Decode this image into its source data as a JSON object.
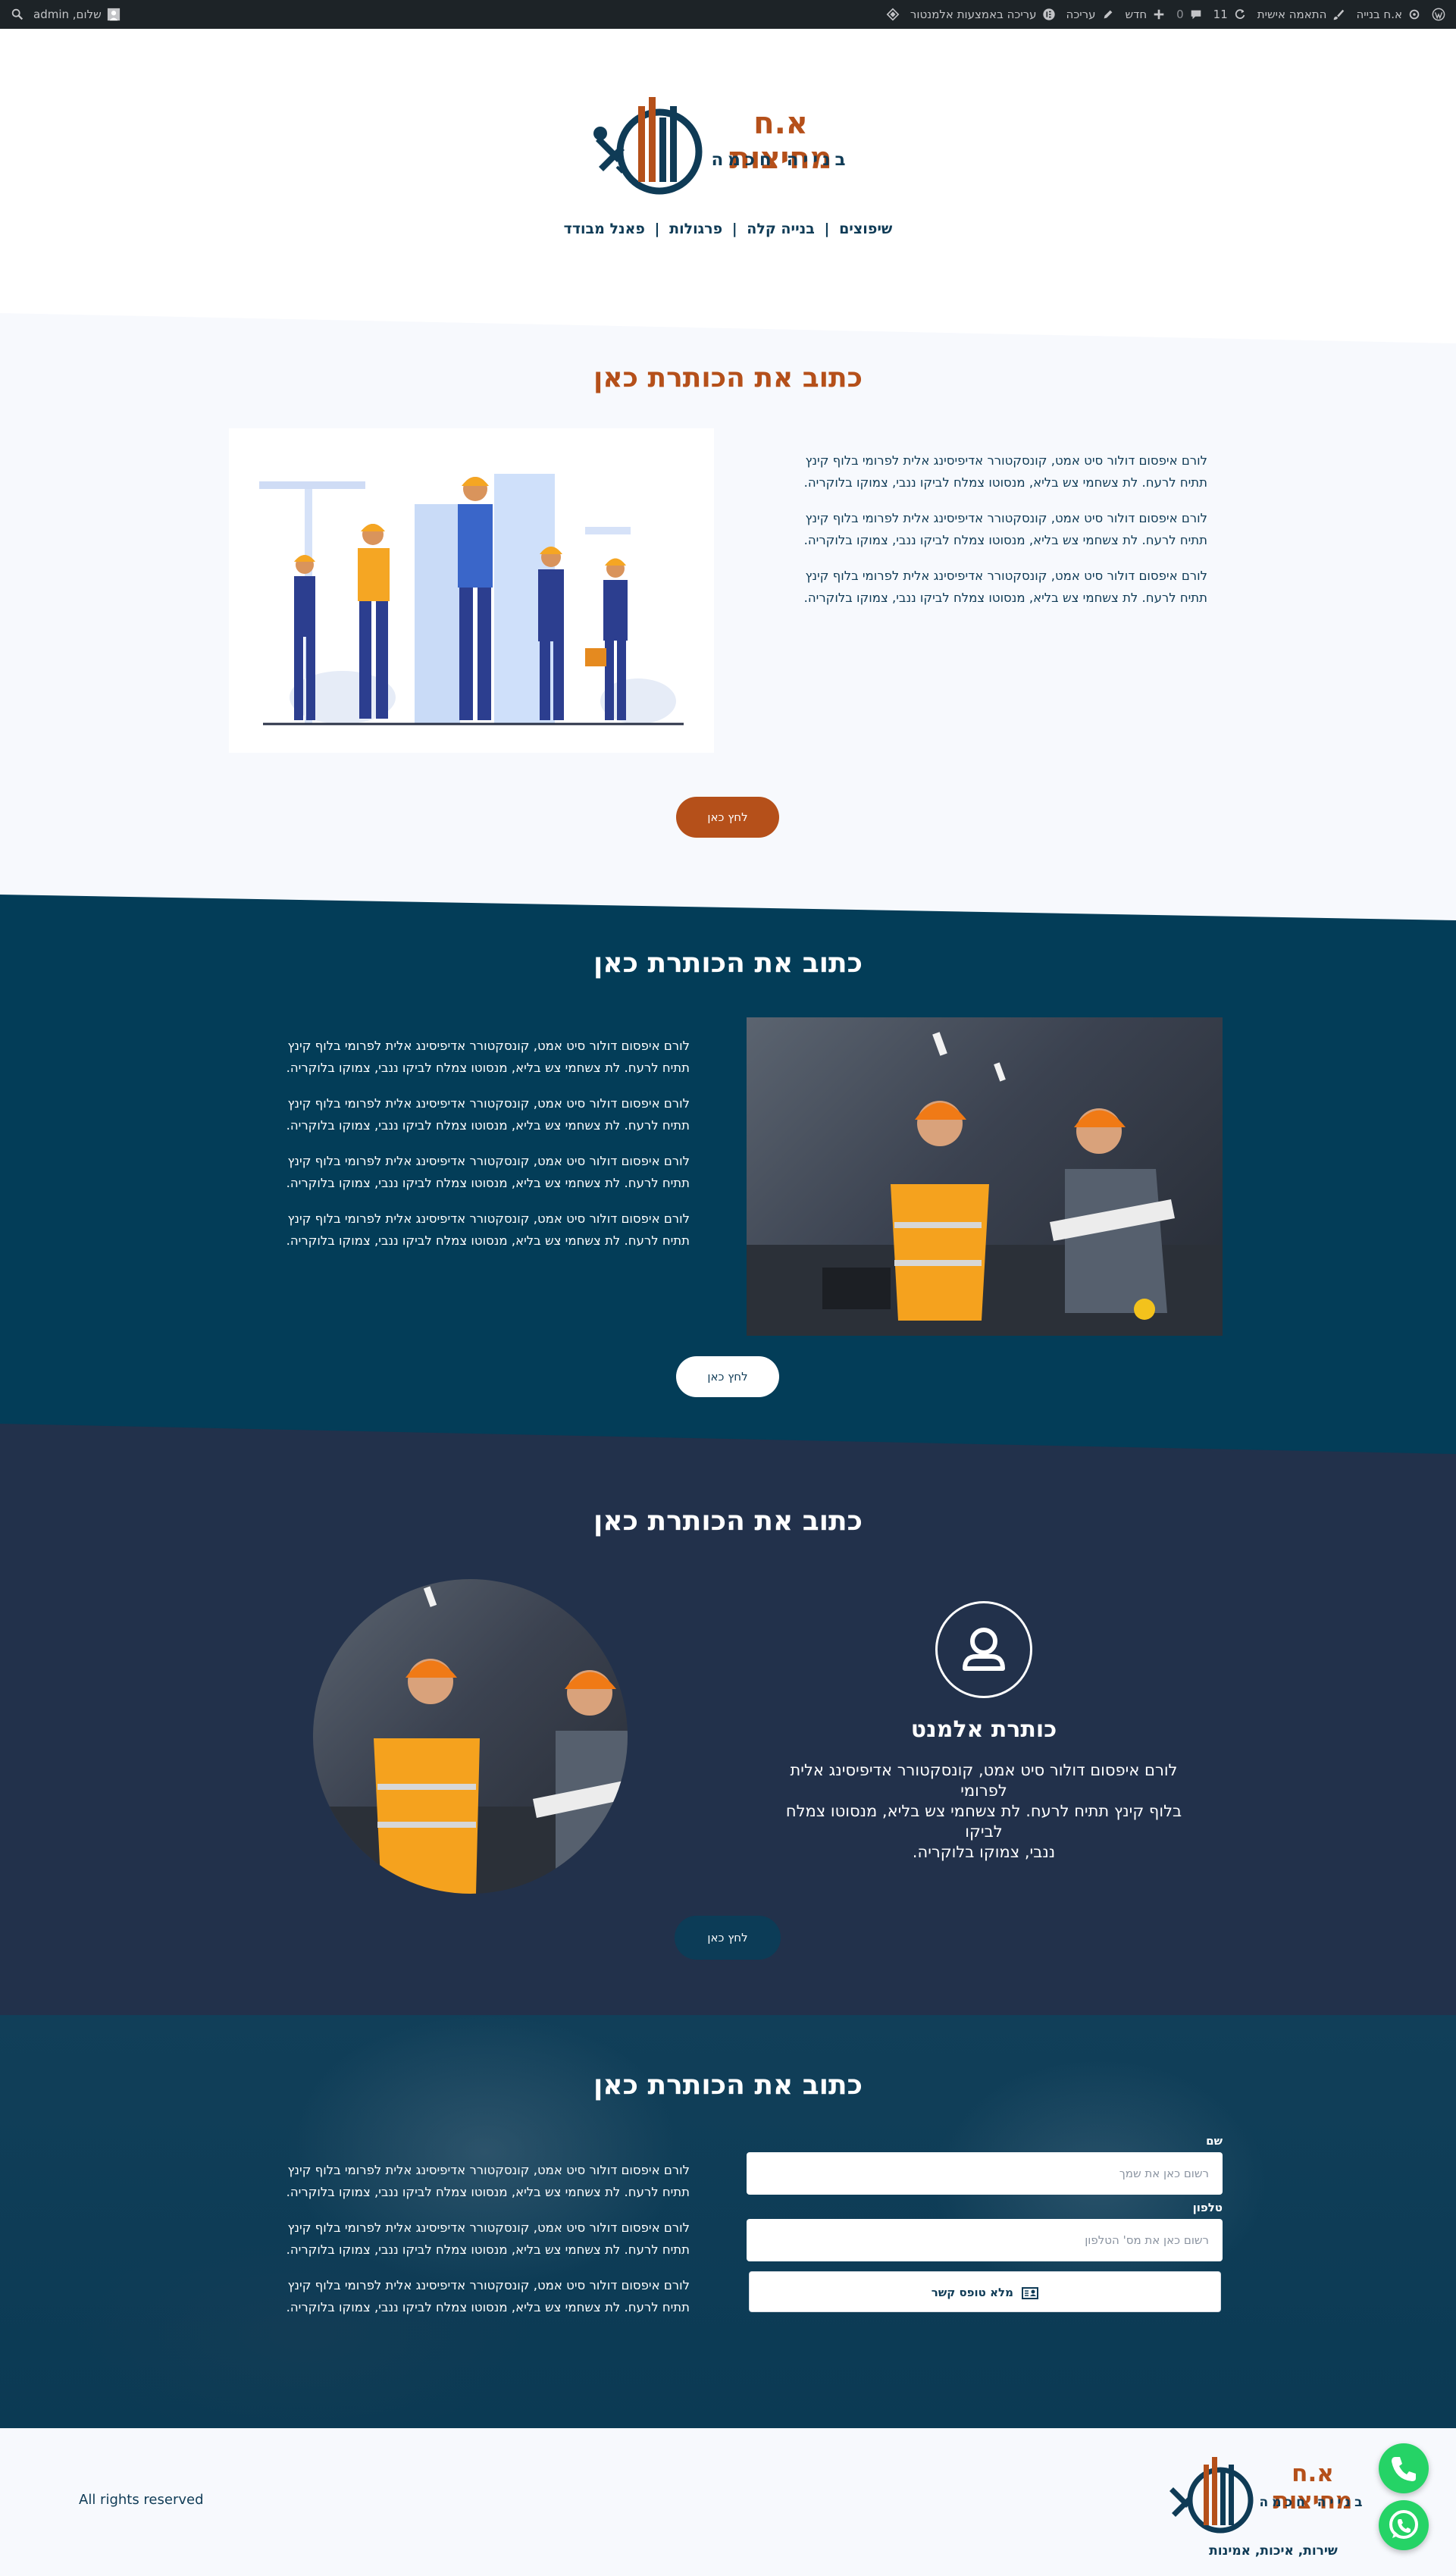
{
  "admin_bar": {
    "site_name": "א.ח בנייה",
    "customize": "התאמה אישית",
    "updates_count": "11",
    "comments_count": "0",
    "new_label": "חדש",
    "edit_label": "עריכה",
    "elementor_label": "עריכה באמצעות אלמנטור",
    "greeting": "שלום, admin"
  },
  "header": {
    "logo_title": "א.ח מחיצות",
    "logo_subtitle": "בנייה חכמה",
    "nav": [
      "שיפוצים",
      "בנייה קלה",
      "פרגולות",
      "פאנל מבודד"
    ],
    "nav_separator": "|"
  },
  "section1": {
    "title": "כתוב את הכותרת כאן",
    "paragraphs": [
      [
        "לורם איפסום דולור סיט אמט, קונסקטורר אדיפיסינג אלית לפרומי בלוף קינץ",
        "תתיח לרעח. לת צשחמי צש בליא, מנסוטו צמלח לביקו ננבי, צמוקו בלוקריה."
      ],
      [
        "לורם איפסום דולור סיט אמט, קונסקטורר אדיפיסינג אלית לפרומי בלוף קינץ",
        "תתיח לרעח. לת צשחמי צש בליא, מנסוטו צמלח לביקו ננבי, צמוקו בלוקריה."
      ],
      [
        "לורם איפסום דולור סיט אמט, קונסקטורר אדיפיסינג אלית לפרומי בלוף קינץ",
        "תתיח לרעח. לת צשחמי צש בליא, מנסוטו צמלח לביקו ננבי, צמוקו בלוקריה."
      ]
    ],
    "button": "לחץ כאן"
  },
  "section2": {
    "title": "כתוב את הכותרת כאן",
    "paragraphs": [
      [
        "לורם איפסום דולור סיט אמט, קונסקטורר אדיפיסינג אלית לפרומי בלוף קינץ",
        "תתיח לרעח. לת צשחמי צש בליא, מנסוטו צמלח לביקו ננבי, צמוקו בלוקריה."
      ],
      [
        "לורם איפסום דולור סיט אמט, קונסקטורר אדיפיסינג אלית לפרומי בלוף קינץ",
        "תתיח לרעח. לת צשחמי צש בליא, מנסוטו צמלח לביקו ננבי, צמוקו בלוקריה."
      ],
      [
        "לורם איפסום דולור סיט אמט, קונסקטורר אדיפיסינג אלית לפרומי בלוף קינץ",
        "תתיח לרעח. לת צשחמי צש בליא, מנסוטו צמלח לביקו ננבי, צמוקו בלוקריה."
      ],
      [
        "לורם איפסום דולור סיט אמט, קונסקטורר אדיפיסינג אלית לפרומי בלוף קינץ",
        "תתיח לרעח. לת צשחמי צש בליא, מנסוטו צמלח לביקו ננבי, צמוקו בלוקריה."
      ]
    ],
    "button": "לחץ כאן"
  },
  "section3": {
    "title": "כתוב את הכותרת כאן",
    "element_title": "כותרת אלמנט",
    "element_text": [
      "לורם איפסום דולור סיט אמט, קונסקטורר אדיפיסינג אלית לפרומי",
      "בלוף קינץ תתיח לרעח. לת צשחמי צש בליא, מנסוטו צמלח לביקו",
      "ננבי, צמוקו בלוקריה."
    ],
    "button": "לחץ כאן"
  },
  "section4": {
    "title": "כתוב את הכותרת כאן",
    "paragraphs": [
      [
        "לורם איפסום דולור סיט אמט, קונסקטורר אדיפיסינג אלית לפרומי בלוף קינץ",
        "תתיח לרעח. לת צשחמי צש בליא, מנסוטו צמלח לביקו ננבי, צמוקו בלוקריה."
      ],
      [
        "לורם איפסום דולור סיט אמט, קונסקטורר אדיפיסינג אלית לפרומי בלוף קינץ",
        "תתיח לרעח. לת צשחמי צש בליא, מנסוטו צמלח לביקו ננבי, צמוקו בלוקריה."
      ],
      [
        "לורם איפסום דולור סיט אמט, קונסקטורר אדיפיסינג אלית לפרומי בלוף קינץ",
        "תתיח לרעח. לת צשחמי צש בליא, מנסוטו צמלח לביקו ננבי, צמוקו בלוקריה."
      ]
    ],
    "form": {
      "name_label": "שם",
      "name_placeholder": "רשום כאן את שמך",
      "phone_label": "טלפון",
      "phone_placeholder": "רשום כאן את מס' הטלפון",
      "submit": "מלא טופס קשר"
    }
  },
  "footer": {
    "rights": "All rights reserved",
    "logo_title": "א.ח מחיצות",
    "logo_subtitle": "בנייה חכמה",
    "tagline": "שירות, איכות, אמינות"
  },
  "colors": {
    "brand_orange": "#b5501a",
    "brand_navy": "#0f3b56",
    "section2_bg": "#033d58",
    "section3_bg": "#22314b",
    "whatsapp_green": "#25d366"
  },
  "icons": [
    "wordpress-icon",
    "home-icon",
    "brush-icon",
    "refresh-icon",
    "comment-icon",
    "plus-icon",
    "pencil-icon",
    "elementor-icon",
    "settings-icon",
    "user-icon",
    "search-icon",
    "avatar-icon",
    "phone-icon",
    "whatsapp-icon",
    "contact-card-icon"
  ]
}
